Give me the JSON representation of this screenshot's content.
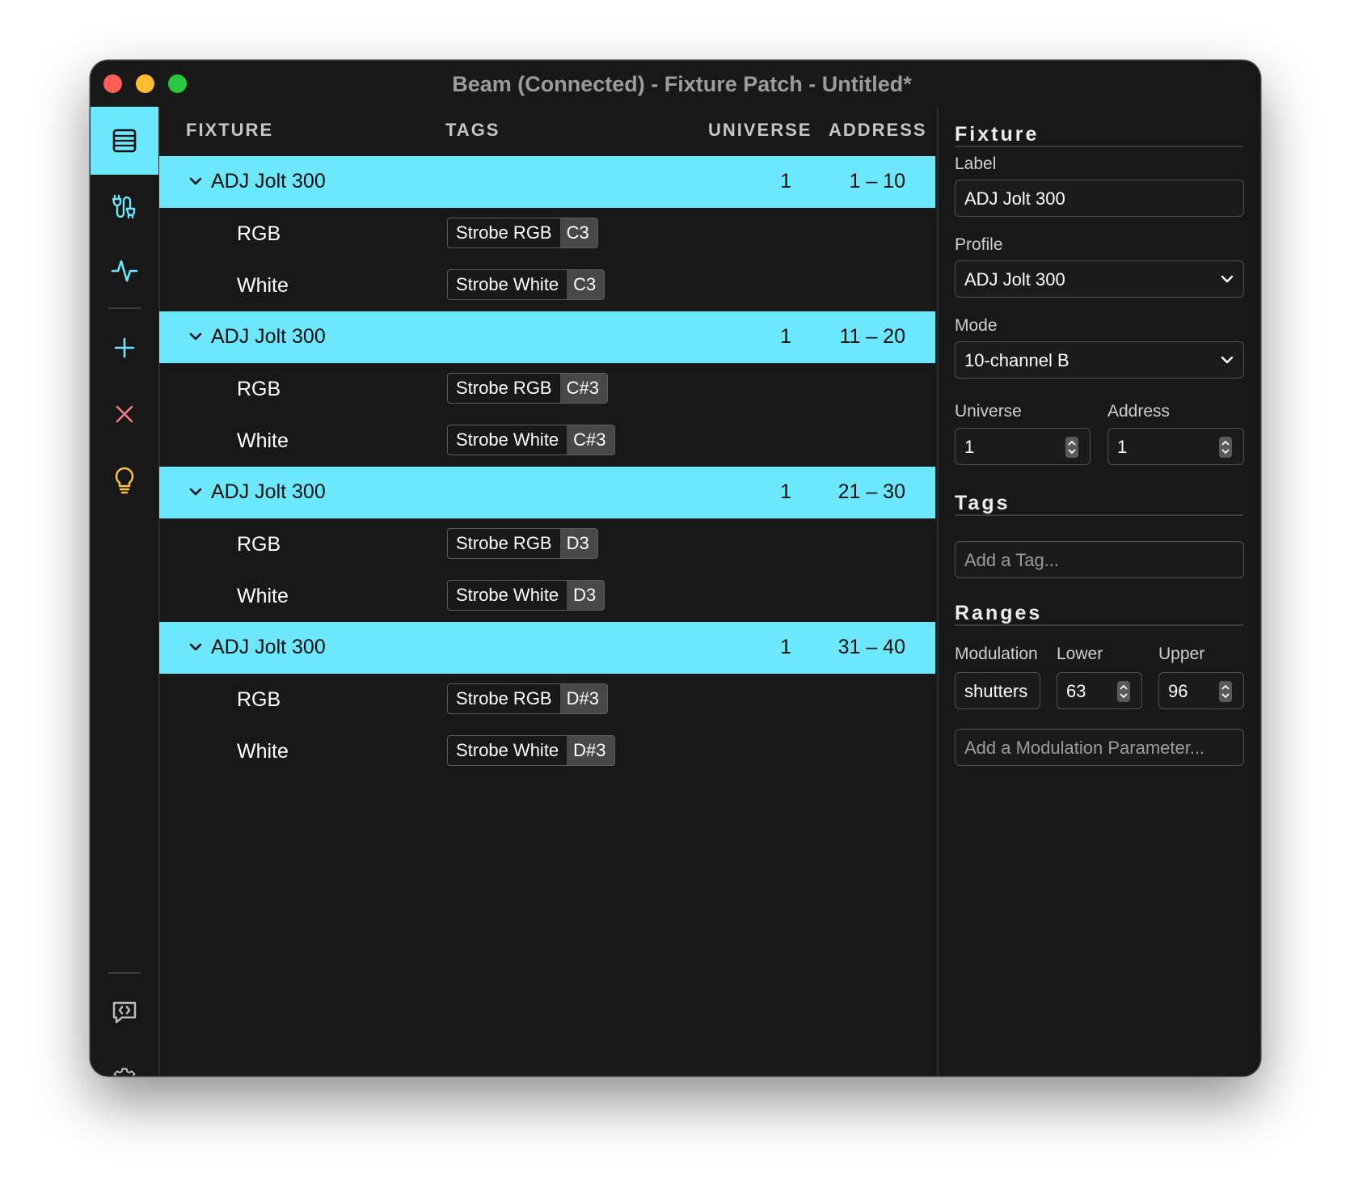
{
  "window": {
    "title": "Beam (Connected) - Fixture Patch - Untitled*"
  },
  "sidebar": {
    "items": [
      {
        "name": "list-icon",
        "active": true
      },
      {
        "name": "patch-cable-icon"
      },
      {
        "name": "activity-icon"
      },
      {
        "name": "add-icon"
      },
      {
        "name": "delete-icon"
      },
      {
        "name": "lightbulb-icon"
      },
      {
        "name": "message-code-icon"
      },
      {
        "name": "gear-icon"
      }
    ],
    "colors": {
      "accent": "#6de7fb",
      "delete": "#f07c7c",
      "bulb": "#f5c542"
    }
  },
  "table": {
    "headers": {
      "fixture": "FIXTURE",
      "tags": "TAGS",
      "universe": "UNIVERSE",
      "address": "ADDRESS"
    },
    "fixtures": [
      {
        "name": "ADJ Jolt 300",
        "universe": "1",
        "address": "1 – 10",
        "channels": [
          {
            "name": "RGB",
            "tag": "Strobe RGB",
            "note": "C3"
          },
          {
            "name": "White",
            "tag": "Strobe White",
            "note": "C3"
          }
        ]
      },
      {
        "name": "ADJ Jolt 300",
        "universe": "1",
        "address": "11 – 20",
        "channels": [
          {
            "name": "RGB",
            "tag": "Strobe RGB",
            "note": "C#3"
          },
          {
            "name": "White",
            "tag": "Strobe White",
            "note": "C#3"
          }
        ]
      },
      {
        "name": "ADJ Jolt 300",
        "universe": "1",
        "address": "21 – 30",
        "channels": [
          {
            "name": "RGB",
            "tag": "Strobe RGB",
            "note": "D3"
          },
          {
            "name": "White",
            "tag": "Strobe White",
            "note": "D3"
          }
        ]
      },
      {
        "name": "ADJ Jolt 300",
        "universe": "1",
        "address": "31 – 40",
        "channels": [
          {
            "name": "RGB",
            "tag": "Strobe RGB",
            "note": "D#3"
          },
          {
            "name": "White",
            "tag": "Strobe White",
            "note": "D#3"
          }
        ]
      }
    ]
  },
  "panel": {
    "fixture_heading": "Fixture",
    "label_label": "Label",
    "label_value": "ADJ Jolt 300",
    "profile_label": "Profile",
    "profile_value": "ADJ Jolt 300",
    "mode_label": "Mode",
    "mode_value": "10-channel B",
    "universe_label": "Universe",
    "universe_value": "1",
    "address_label": "Address",
    "address_value": "1",
    "tags_heading": "Tags",
    "tag_placeholder": "Add a Tag...",
    "ranges_heading": "Ranges",
    "modulation_label": "Modulation",
    "lower_label": "Lower",
    "upper_label": "Upper",
    "modulation_value": "shutters",
    "lower_value": "63",
    "upper_value": "96",
    "modulation_placeholder": "Add a Modulation Parameter..."
  }
}
